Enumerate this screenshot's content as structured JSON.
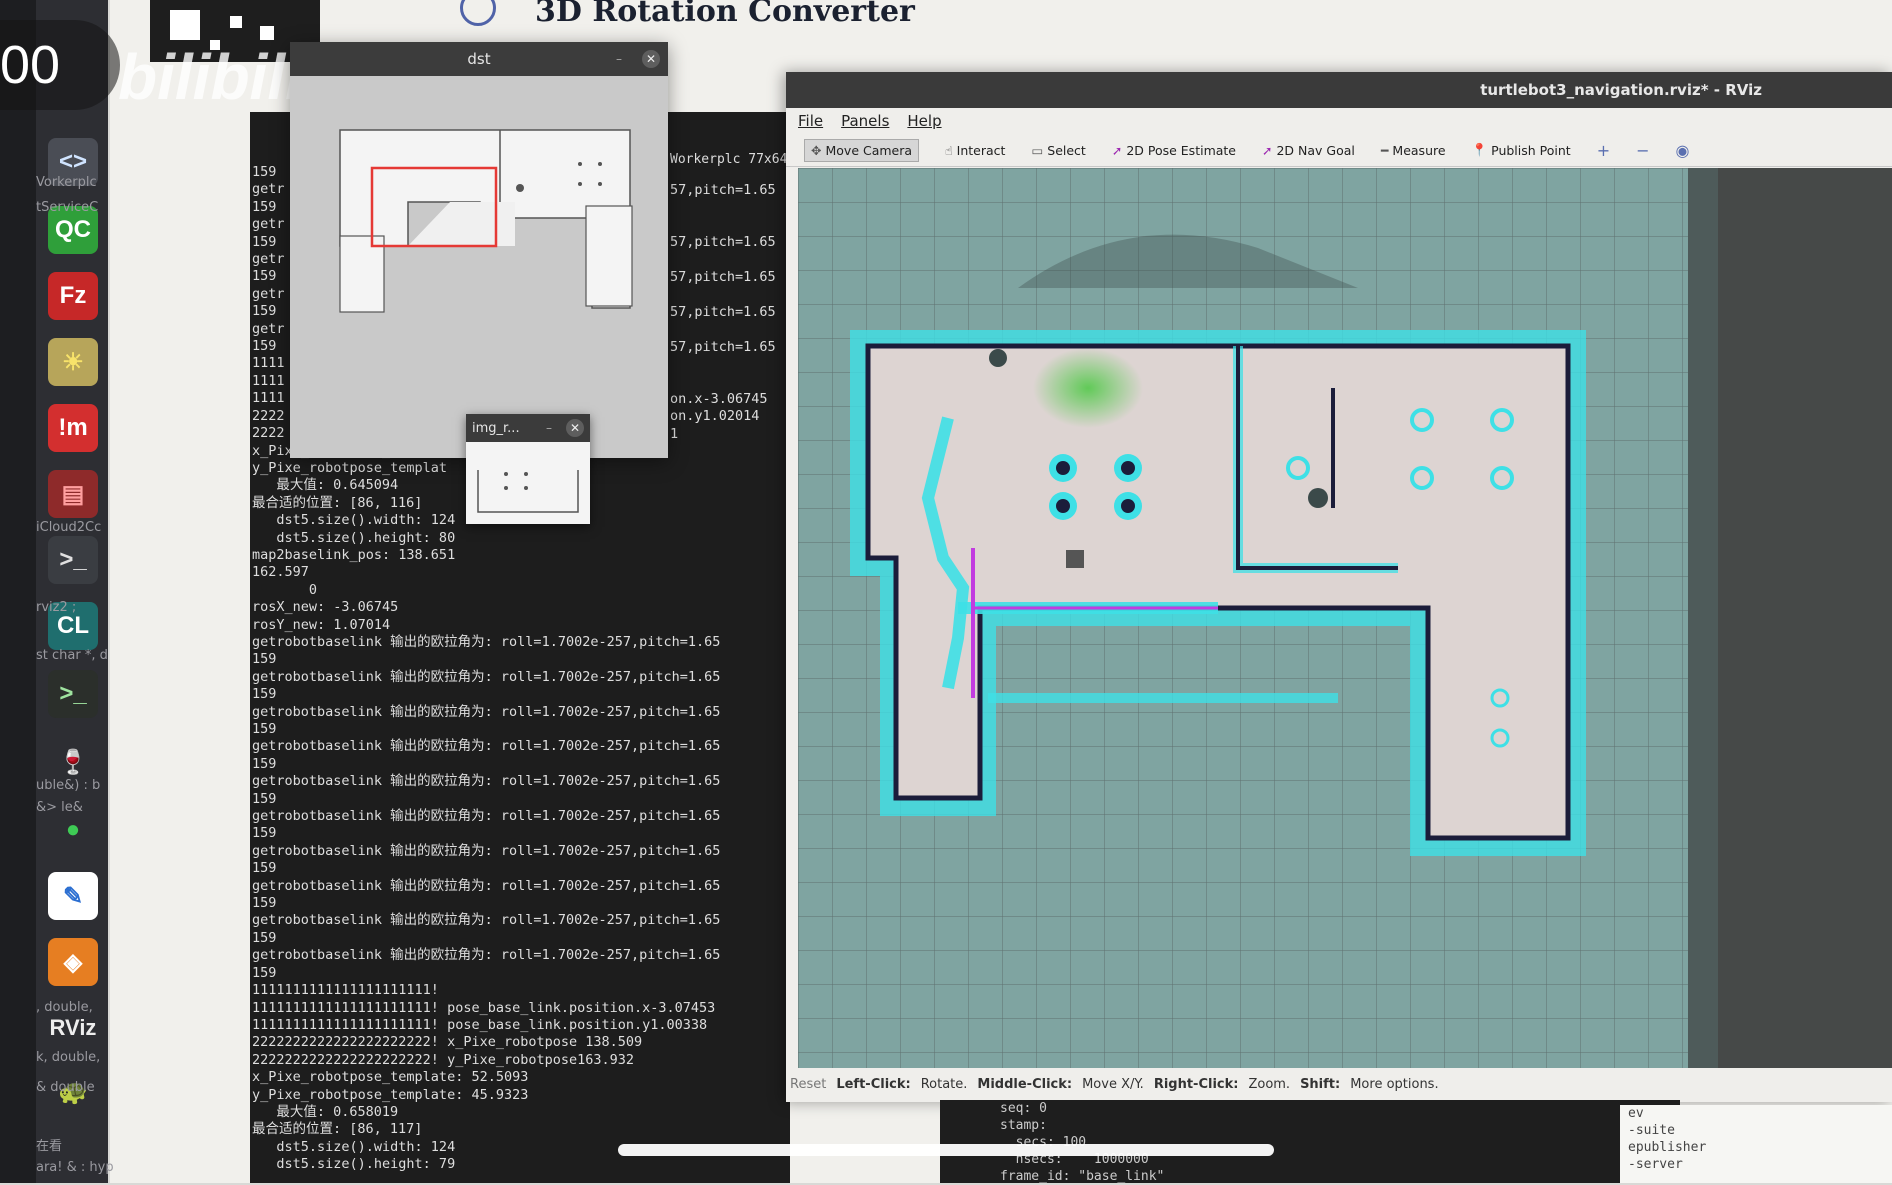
{
  "timer": "00",
  "watermark": "bilibili",
  "page_header": "3D Rotation Converter",
  "dock": {
    "icons": [
      {
        "name": "code-icon",
        "glyph": "<>",
        "bg": "#4a4d55",
        "fg": "#d0e4ff"
      },
      {
        "name": "qc-icon",
        "glyph": "QC",
        "bg": "#2f9f3a",
        "fg": "#ffffff"
      },
      {
        "name": "filezilla-icon",
        "glyph": "Fz",
        "bg": "#c62828",
        "fg": "#ffffff"
      },
      {
        "name": "sun-icon",
        "glyph": "☀",
        "bg": "#b7a55a",
        "fg": "#f8e36a"
      },
      {
        "name": "im-icon",
        "glyph": "!m",
        "bg": "#d32f2f",
        "fg": "#ffffff"
      },
      {
        "name": "red-app-icon",
        "glyph": "▤",
        "bg": "#8e2a2a",
        "fg": "#ff9f9f"
      },
      {
        "name": "terminal-small-icon",
        "glyph": ">_",
        "bg": "#3a3d42",
        "fg": "#e0e0e0"
      },
      {
        "name": "clion-icon",
        "glyph": "CL",
        "bg": "#1f6e6e",
        "fg": "#ffffff"
      },
      {
        "name": "terminal-icon",
        "glyph": ">_",
        "bg": "#2b2f2b",
        "fg": "#9fe39f"
      },
      {
        "name": "wine-icon",
        "glyph": "🍷",
        "bg": "transparent",
        "fg": "#c0392b"
      },
      {
        "name": "wechat-icon",
        "glyph": "●",
        "bg": "transparent",
        "fg": "#3ecb55"
      },
      {
        "name": "edit-icon",
        "glyph": "✎",
        "bg": "#ffffff",
        "fg": "#2c6fd1"
      },
      {
        "name": "layers-icon",
        "glyph": "◈",
        "bg": "#e67e22",
        "fg": "#ffffff"
      },
      {
        "name": "rviz-icon",
        "glyph": "RViz",
        "bg": "transparent",
        "fg": "#eeeeee"
      },
      {
        "name": "turtle-icon",
        "glyph": "🐢",
        "bg": "transparent",
        "fg": "#aaaaaa"
      }
    ],
    "side_texts": [
      "Vorkerplc",
      "tServiceC",
      "iCloud2Cc",
      "rviz2 ;",
      "st char *, d",
      "uble&) : b",
      "&>  le&",
      ", double,",
      "k, double,",
      "& double",
      "在看",
      "ara! & : hyp"
    ]
  },
  "dst_window": {
    "title": "dst"
  },
  "imgr_window": {
    "title": "img_r..."
  },
  "terminal": {
    "title": "Workerplc 77x64",
    "lines": [
      "159",
      "getr",
      "159",
      "getr",
      "159",
      "getr",
      "159",
      "getr",
      "159",
      "getr",
      "159",
      "1111",
      "1111",
      "1111",
      "2222",
      "2222",
      "x_Pixe_robotpose_templat",
      "y_Pixe_robotpose_templat",
      "   最大值: 0.645094",
      "最合适的位置: [86, 116]",
      "   dst5.size().width: 124",
      "   dst5.size().height: 80",
      "map2baselink_pos: 138.651",
      "162.597",
      "       0",
      "rosX_new: -3.06745",
      "rosY_new: 1.07014",
      "getrobotbaselink 输出的欧拉角为: roll=1.7002e-257,pitch=1.65",
      "159",
      "getrobotbaselink 输出的欧拉角为: roll=1.7002e-257,pitch=1.65",
      "159",
      "getrobotbaselink 输出的欧拉角为: roll=1.7002e-257,pitch=1.65",
      "159",
      "getrobotbaselink 输出的欧拉角为: roll=1.7002e-257,pitch=1.65",
      "159",
      "getrobotbaselink 输出的欧拉角为: roll=1.7002e-257,pitch=1.65",
      "159",
      "getrobotbaselink 输出的欧拉角为: roll=1.7002e-257,pitch=1.65",
      "159",
      "getrobotbaselink 输出的欧拉角为: roll=1.7002e-257,pitch=1.65",
      "159",
      "getrobotbaselink 输出的欧拉角为: roll=1.7002e-257,pitch=1.65",
      "159",
      "getrobotbaselink 输出的欧拉角为: roll=1.7002e-257,pitch=1.65",
      "159",
      "getrobotbaselink 输出的欧拉角为: roll=1.7002e-257,pitch=1.65",
      "159",
      "1111111111111111111111!",
      "1111111111111111111111! pose_base_link.position.x-3.07453",
      "1111111111111111111111! pose_base_link.position.y1.00338",
      "2222222222222222222222! x_Pixe_robotpose 138.509",
      "2222222222222222222222! y_Pixe_robotpose163.932",
      "x_Pixe_robotpose_template: 52.5093",
      "y_Pixe_robotpose_template: 45.9323",
      "   最大值: 0.658019",
      "最合适的位置: [86, 117]",
      "   dst5.size().width: 124",
      "   dst5.size().height: 79"
    ],
    "right_lines": [
      "57,pitch=1.65",
      "",
      "",
      "57,pitch=1.65",
      "",
      "57,pitch=1.65",
      "",
      "57,pitch=1.65",
      "",
      "57,pitch=1.65",
      "",
      "",
      "on.x-3.06745",
      "on.y1.02014",
      "1"
    ]
  },
  "rviz": {
    "title": "turtlebot3_navigation.rviz* - RViz",
    "menu": [
      "File",
      "Panels",
      "Help"
    ],
    "tools": [
      {
        "name": "move-camera",
        "label": "Move Camera",
        "icon": "✥"
      },
      {
        "name": "interact",
        "label": "Interact",
        "icon": "☝"
      },
      {
        "name": "select",
        "label": "Select",
        "icon": "▭"
      },
      {
        "name": "2d-pose-estimate",
        "label": "2D Pose Estimate",
        "icon": "➚"
      },
      {
        "name": "2d-nav-goal",
        "label": "2D Nav Goal",
        "icon": "➚"
      },
      {
        "name": "measure",
        "label": "Measure",
        "icon": "━"
      },
      {
        "name": "publish-point",
        "label": "Publish Point",
        "icon": "📍"
      }
    ],
    "extra_tools": [
      "+",
      "−",
      "◉"
    ],
    "status": {
      "reset": "Reset",
      "left_click": "Left-Click:",
      "left_action": "Rotate.",
      "middle_click": "Middle-Click:",
      "middle_action": "Move X/Y.",
      "right_click": "Right-Click:",
      "right_action": "Zoom.",
      "shift": "Shift:",
      "shift_action": "More options."
    }
  },
  "bottom_term": [
    "seq: 0",
    "stamp:",
    "  secs: 100",
    "  nsecs:    1000000",
    "frame_id: \"base_link\""
  ],
  "bottom_right": [
    "ev",
    "-suite",
    "epublisher",
    "-server"
  ],
  "colors": {
    "map_bg": "#4a5857",
    "map_floor": "#ddd4d2",
    "inflation": "#3ee0e6",
    "wall": "#1b1d3a",
    "path": "#c23ce0"
  }
}
